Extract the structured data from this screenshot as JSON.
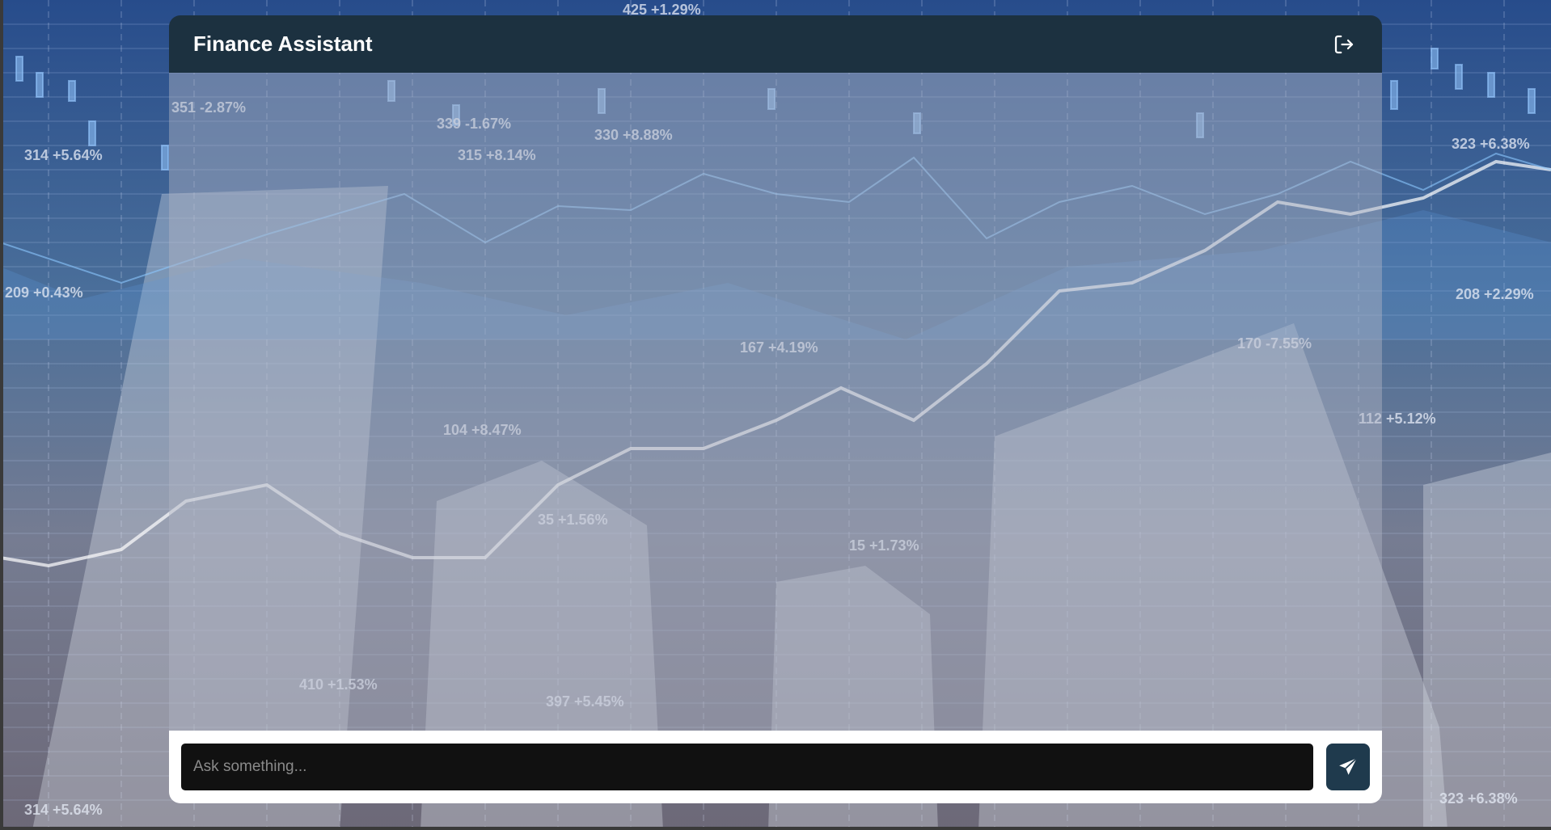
{
  "header": {
    "title": "Finance Assistant",
    "logout_icon": "logout-icon"
  },
  "composer": {
    "placeholder": "Ask something...",
    "send_icon": "paper-plane-icon"
  },
  "background": {
    "labels": [
      "425 +1.29%",
      "351 -2.87%",
      "339 -1.67%",
      "330 +8.88%",
      "315 +8.14%",
      "314 +5.64%",
      "323 +6.38%",
      "209 +0.43%",
      "208 +2.29%",
      "167 +4.19%",
      "170 -7.55%",
      "104 +8.47%",
      "112 +5.12%",
      "35 +1.56%",
      "15 +1.73%",
      "410 +1.53%",
      "397 +5.45%",
      "314 +5.64%",
      "323 +6.38%"
    ]
  },
  "colors": {
    "header_bg": "#1c3140",
    "send_bg": "#1f3a4d",
    "input_bg": "#111111",
    "footer_bg": "#ffffff"
  }
}
